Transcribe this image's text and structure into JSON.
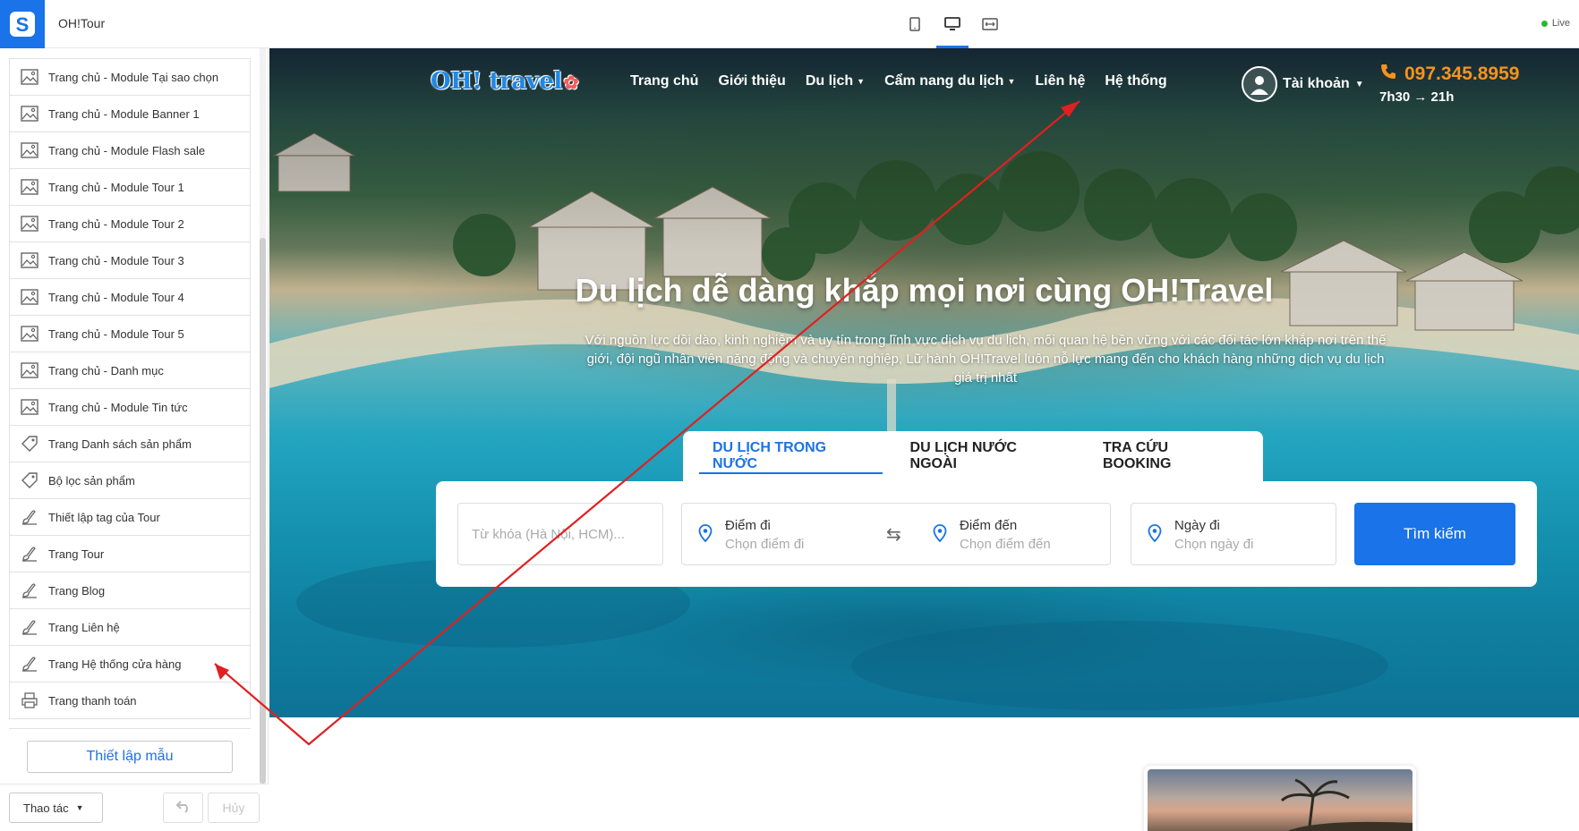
{
  "app": {
    "store_name": "OH!Tour",
    "live_label": "Live"
  },
  "sidebar": {
    "items": [
      {
        "label": "Trang chủ - Module Tại sao chọn",
        "icon": "image-icon"
      },
      {
        "label": "Trang chủ - Module Banner 1",
        "icon": "image-icon"
      },
      {
        "label": "Trang chủ - Module Flash sale",
        "icon": "image-icon"
      },
      {
        "label": "Trang chủ - Module Tour 1",
        "icon": "image-icon"
      },
      {
        "label": "Trang chủ - Module Tour 2",
        "icon": "image-icon"
      },
      {
        "label": "Trang chủ - Module Tour 3",
        "icon": "image-icon"
      },
      {
        "label": "Trang chủ - Module Tour 4",
        "icon": "image-icon"
      },
      {
        "label": "Trang chủ - Module Tour 5",
        "icon": "image-icon"
      },
      {
        "label": "Trang chủ - Danh mục",
        "icon": "image-icon"
      },
      {
        "label": "Trang chủ - Module Tin tức",
        "icon": "image-icon"
      },
      {
        "label": "Trang Danh sách sản phẩm",
        "icon": "tag-icon"
      },
      {
        "label": "Bộ lọc sản phẩm",
        "icon": "tag-icon"
      },
      {
        "label": "Thiết lập tag của Tour",
        "icon": "brush-icon"
      },
      {
        "label": "Trang Tour",
        "icon": "brush-icon"
      },
      {
        "label": "Trang Blog",
        "icon": "brush-icon"
      },
      {
        "label": "Trang Liên hệ",
        "icon": "brush-icon"
      },
      {
        "label": "Trang Hệ thống cửa hàng",
        "icon": "brush-icon"
      },
      {
        "label": "Trang thanh toán",
        "icon": "printer-icon"
      }
    ],
    "setup_label": "Thiết lập mẫu",
    "actions_label": "Thao tác",
    "cancel_label": "Hủy"
  },
  "site": {
    "logo": "OH! travel",
    "nav": [
      {
        "label": "Trang chủ",
        "dropdown": false
      },
      {
        "label": "Giới thiệu",
        "dropdown": false
      },
      {
        "label": "Du lịch",
        "dropdown": true
      },
      {
        "label": "Cẩm nang du lịch",
        "dropdown": true
      },
      {
        "label": "Liên hệ",
        "dropdown": false
      },
      {
        "label": "Hệ thống",
        "dropdown": false
      }
    ],
    "account_label": "Tài khoản",
    "phone": "097.345.8959",
    "hours": "7h30 → 21h",
    "hero_title": "Du lịch dễ dàng khắp mọi nơi cùng OH!Travel",
    "hero_desc": "Với nguồn lực dồi dào, kinh nghiệm và uy tín trong lĩnh vực dịch vụ du lịch, mối quan hệ bền vững với các đối tác lớn khắp nơi trên thế giới, đội ngũ nhân viên năng động và chuyên nghiệp, Lữ hành OH!Travel luôn nỗ lực mang đến cho khách hàng những dịch vụ du lịch giá trị nhất",
    "tabs": [
      "DU LỊCH TRONG NƯỚC",
      "DU LỊCH NƯỚC NGOÀI",
      "TRA CỨU BOOKING"
    ],
    "search": {
      "keyword_placeholder": "Từ khóa (Hà Nội, HCM)...",
      "from_label": "Điểm đi",
      "from_placeholder": "Chọn điểm đi",
      "to_label": "Điểm đến",
      "to_placeholder": "Chọn điểm đến",
      "date_label": "Ngày đi",
      "date_placeholder": "Chọn ngày đi",
      "button_label": "Tìm kiếm"
    }
  },
  "colors": {
    "accent": "#1a73e8",
    "phone": "#f7931e",
    "annotation": "#e02020"
  }
}
